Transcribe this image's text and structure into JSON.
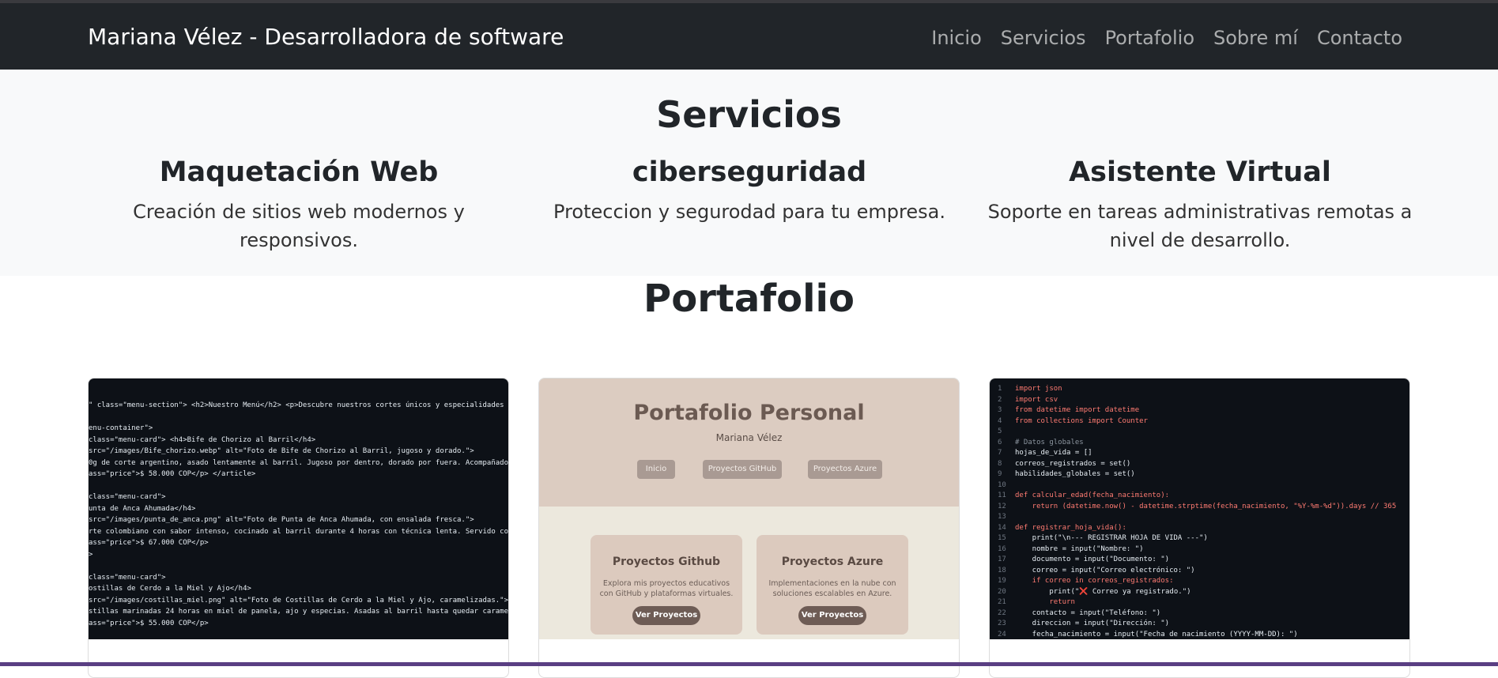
{
  "navbar": {
    "brand": "Mariana Vélez - Desarrolladora de software",
    "links": [
      "Inicio",
      "Servicios",
      "Portafolio",
      "Sobre mí",
      "Contacto"
    ]
  },
  "services": {
    "title": "Servicios",
    "items": [
      {
        "title": "Maquetación Web",
        "desc": "Creación de sitios web modernos y responsivos."
      },
      {
        "title": "ciberseguridad",
        "desc": "Proteccion y segurodad para tu empresa."
      },
      {
        "title": "Asistente Virtual",
        "desc": "Soporte en tareas administrativas remotas a nivel de desarrollo."
      }
    ]
  },
  "portfolio": {
    "title": "Portafolio",
    "html_code": [
      "\" class=\"menu-section\"> <h2>Nuestro Menú</h2> <p>Descubre nuestros cortes únicos y especialidades ahumadas dir",
      "",
      "enu-container\">",
      "class=\"menu-card\"> <h4>Bife de Chorizo al Barril</h4>",
      "src=\"/images/Bife_chorizo.webp\" alt=\"Foto de Bife de Chorizo al Barril, jugoso y dorado.\">",
      "0g de corte argentino, asado lentamente al barril. Jugoso por dentro, dorado por fuera. Acompañado de papas rú",
      "ass=\"price\">$ 58.000 COP</p> </article>",
      "",
      "class=\"menu-card\">",
      "unta de Anca Ahumada</h4>",
      "src=\"/images/punta_de_anca.png\" alt=\"Foto de Punta de Anca Ahumada, con ensalada fresca.\">",
      "rte colombiano con sabor intenso, cocinado al barril durante 4 horas con técnica lenta. Servido con ensalada f",
      "ass=\"price\">$ 67.000 COP</p>",
      ">",
      "",
      "class=\"menu-card\">",
      "ostillas de Cerdo a la Miel y Ajo</h4>",
      "src=\"/images/costillas_miel.png\" alt=\"Foto de Costillas de Cerdo a la Miel y Ajo, caramelizadas.\">",
      "stillas marinadas 24 horas en miel de panela, ajo y especias. Asadas al barril hasta quedar caramelizadas y su",
      "ass=\"price\">$ 55.000 COP</p>"
    ],
    "personal": {
      "title": "Portafolio Personal",
      "subtitle": "Mariana Vélez",
      "buttons": [
        "Inicio",
        "Proyectos GitHub",
        "Proyectos Azure"
      ],
      "cards": [
        {
          "title": "Proyectos Github",
          "desc": "Explora mis proyectos educativos con GitHub y plataformas virtuales.",
          "button": "Ver Proyectos"
        },
        {
          "title": "Proyectos Azure",
          "desc": "Implementaciones en la nube con soluciones escalables en Azure.",
          "button": "Ver Proyectos"
        }
      ]
    },
    "python_code": [
      {
        "n": "1",
        "t": "import json"
      },
      {
        "n": "2",
        "t": "import csv"
      },
      {
        "n": "3",
        "t": "from datetime import datetime"
      },
      {
        "n": "4",
        "t": "from collections import Counter"
      },
      {
        "n": "5",
        "t": ""
      },
      {
        "n": "6",
        "t": "# Datos globales"
      },
      {
        "n": "7",
        "t": "hojas_de_vida = []"
      },
      {
        "n": "8",
        "t": "correos_registrados = set()"
      },
      {
        "n": "9",
        "t": "habilidades_globales = set()"
      },
      {
        "n": "10",
        "t": ""
      },
      {
        "n": "11",
        "t": "def calcular_edad(fecha_nacimiento):"
      },
      {
        "n": "12",
        "t": "    return (datetime.now() - datetime.strptime(fecha_nacimiento, \"%Y-%m-%d\")).days // 365"
      },
      {
        "n": "13",
        "t": ""
      },
      {
        "n": "14",
        "t": "def registrar_hoja_vida():"
      },
      {
        "n": "15",
        "t": "    print(\"\\n--- REGISTRAR HOJA DE VIDA ---\")"
      },
      {
        "n": "16",
        "t": "    nombre = input(\"Nombre: \")"
      },
      {
        "n": "17",
        "t": "    documento = input(\"Documento: \")"
      },
      {
        "n": "18",
        "t": "    correo = input(\"Correo electrónico: \")"
      },
      {
        "n": "19",
        "t": "    if correo in correos_registrados:"
      },
      {
        "n": "20",
        "t": "        print(\"❌ Correo ya registrado.\")"
      },
      {
        "n": "21",
        "t": "        return"
      },
      {
        "n": "22",
        "t": "    contacto = input(\"Teléfono: \")"
      },
      {
        "n": "23",
        "t": "    direccion = input(\"Dirección: \")"
      },
      {
        "n": "24",
        "t": "    fecha_nacimiento = input(\"Fecha de nacimiento (YYYY-MM-DD): \")"
      }
    ]
  }
}
